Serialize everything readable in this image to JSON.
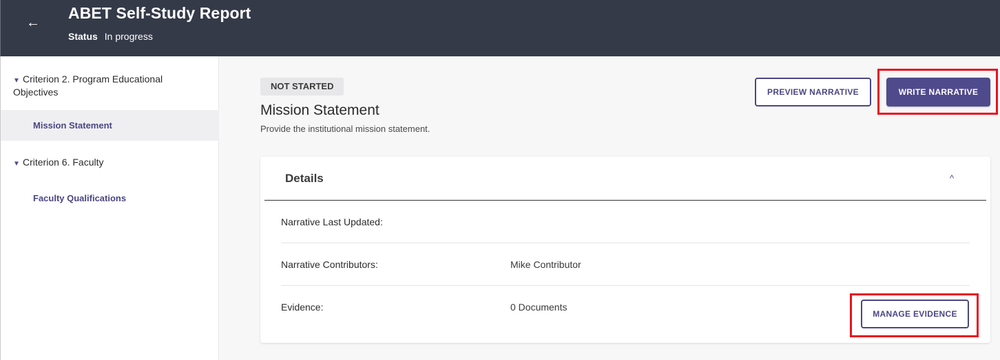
{
  "header": {
    "back_icon": "arrow-left-icon",
    "title": "ABET Self-Study Report",
    "status_label": "Status",
    "status_value": "In progress"
  },
  "sidebar": {
    "criteria": [
      {
        "label": "Criterion 2. Program Educational Objectives",
        "expanded_icon": "caret-down-icon",
        "items": [
          {
            "label": "Mission Statement",
            "active": true
          }
        ]
      },
      {
        "label": "Criterion 6. Faculty",
        "expanded_icon": "caret-down-icon",
        "items": [
          {
            "label": "Faculty Qualifications",
            "active": false
          }
        ]
      }
    ]
  },
  "main": {
    "status_badge": "NOT STARTED",
    "title": "Mission Statement",
    "subtitle": "Provide the institutional mission statement.",
    "preview_button": "PREVIEW NARRATIVE",
    "write_button": "WRITE NARRATIVE",
    "details": {
      "title": "Details",
      "collapse_icon": "chevron-up-icon",
      "rows": [
        {
          "label": "Narrative Last Updated:",
          "value": ""
        },
        {
          "label": "Narrative Contributors:",
          "value": "Mike Contributor"
        },
        {
          "label": "Evidence:",
          "value": "0 Documents"
        }
      ],
      "manage_button": "MANAGE EVIDENCE"
    }
  },
  "colors": {
    "header_bg": "#343a48",
    "accent": "#4f4a8c",
    "highlight": "#e8121e",
    "page_bg": "#f7f7f8"
  }
}
